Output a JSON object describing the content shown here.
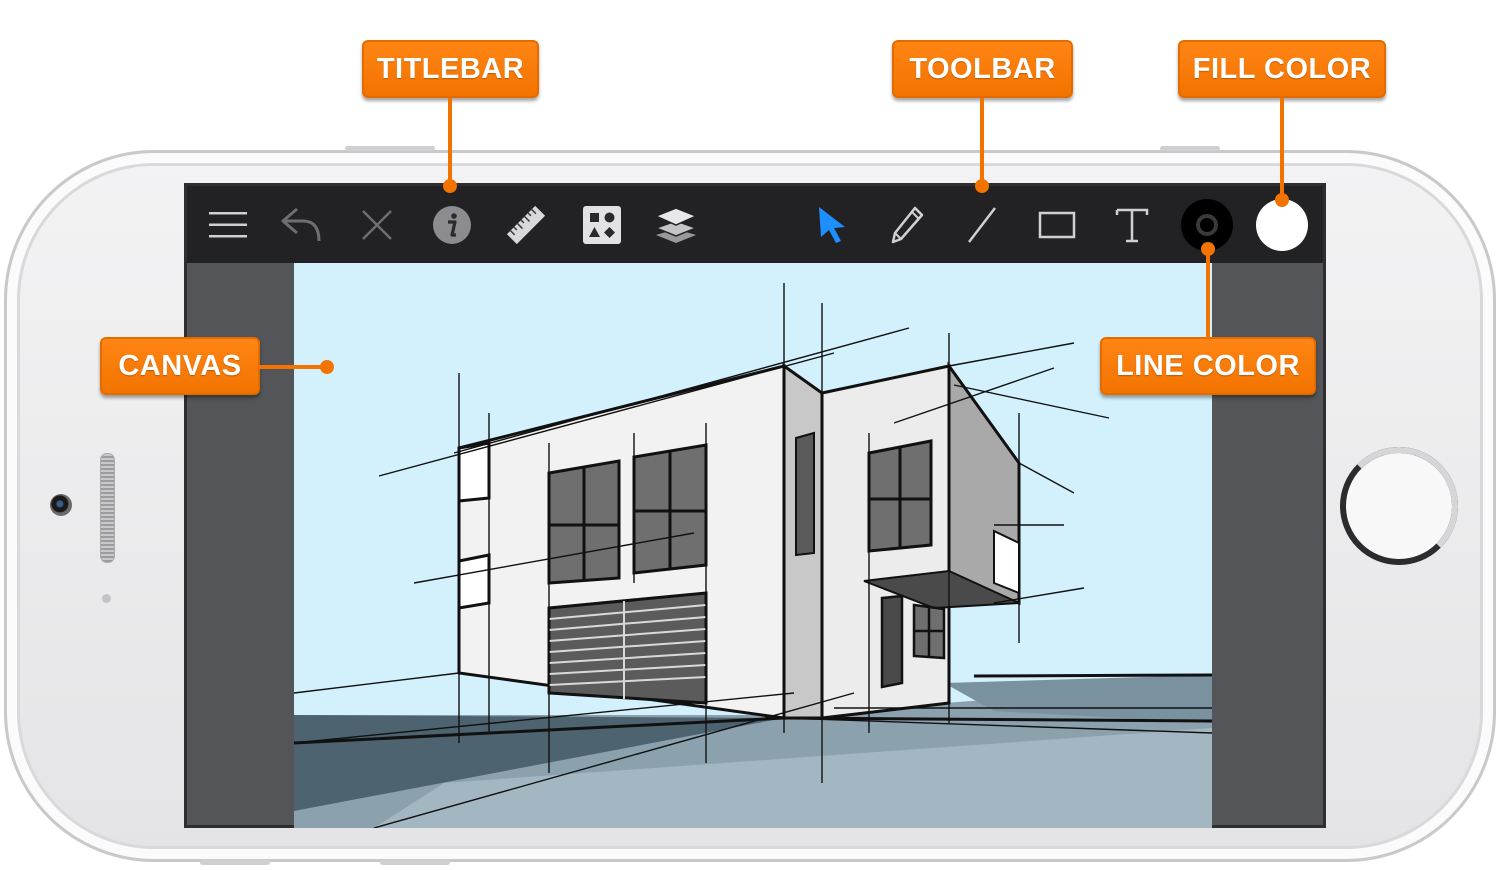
{
  "callouts": {
    "titlebar": "TITLEBAR",
    "toolbar": "TOOLBAR",
    "fill_color": "FILL COLOR",
    "canvas": "CANVAS",
    "line_color": "LINE COLOR"
  },
  "titlebar_buttons": [
    "menu-icon",
    "undo-icon",
    "close-icon",
    "info-icon",
    "ruler-icon",
    "shapes-library-icon",
    "layers-icon"
  ],
  "toolbar_tools": [
    "select-arrow-icon",
    "pencil-icon",
    "line-icon",
    "rectangle-icon",
    "text-icon"
  ],
  "colors": {
    "accent_orange": "#f27300",
    "select_tool": "#1e8fff",
    "line_color_swatch": "#000000",
    "fill_color_swatch": "#ffffff",
    "sky": "#d3f1fd",
    "ground": "#6f8794"
  }
}
